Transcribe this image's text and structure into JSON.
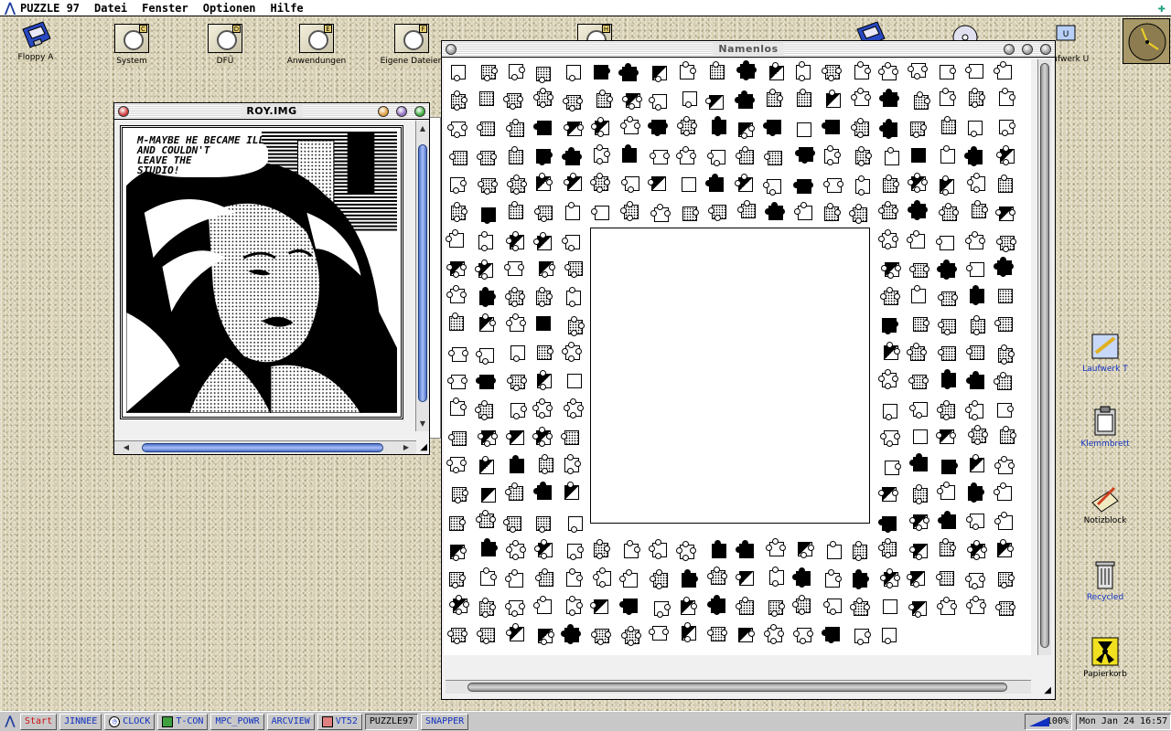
{
  "menubar": {
    "app_name": "PUZZLE 97",
    "menus": [
      "Datei",
      "Fenster",
      "Optionen",
      "Hilfe"
    ]
  },
  "desktop_icons": [
    {
      "label": "Floppy A",
      "letter": "A"
    },
    {
      "label": "System",
      "letter": "C"
    },
    {
      "label": "DFÜ",
      "letter": "D"
    },
    {
      "label": "Anwendungen",
      "letter": "E"
    },
    {
      "label": "Eigene Dateien",
      "letter": "F"
    },
    {
      "label": "",
      "letter": "H"
    },
    {
      "label": "",
      "letter": "O"
    },
    {
      "label": "",
      "letter": "S"
    },
    {
      "label": "Laufwerk U",
      "letter": "U"
    }
  ],
  "roy_window": {
    "title": "ROY.IMG",
    "speech_text": "M-MAYBE HE BECAME ILL\nAND COULDN'T\nLEAVE THE\nSTUDIO!"
  },
  "puzzle_window": {
    "title": "Namenlos"
  },
  "right_icons": [
    {
      "label": "Laufwerk T",
      "icon": "drive-t-icon"
    },
    {
      "label": "Klemmbrett",
      "icon": "clipboard-icon"
    },
    {
      "label": "Notizblock",
      "icon": "notepad-icon"
    },
    {
      "label": "Recycled",
      "icon": "recycle-bin-icon"
    },
    {
      "label": "Papierkorb",
      "icon": "radiation-trash-icon"
    }
  ],
  "taskbar": {
    "buttons": [
      "Start",
      "JINNEE",
      "CLOCK",
      "T-CON",
      "MPC_POWR",
      "ARCVIEW",
      "VT52",
      "PUZZLE97",
      "SNAPPER"
    ],
    "active": "PUZZLE97",
    "volume": "100%",
    "clock": "Mon Jan 24 16:57"
  },
  "colors": {
    "desktop": "#d8d0b4",
    "accent_blue": "#1030c0",
    "start_red": "#d01010"
  }
}
